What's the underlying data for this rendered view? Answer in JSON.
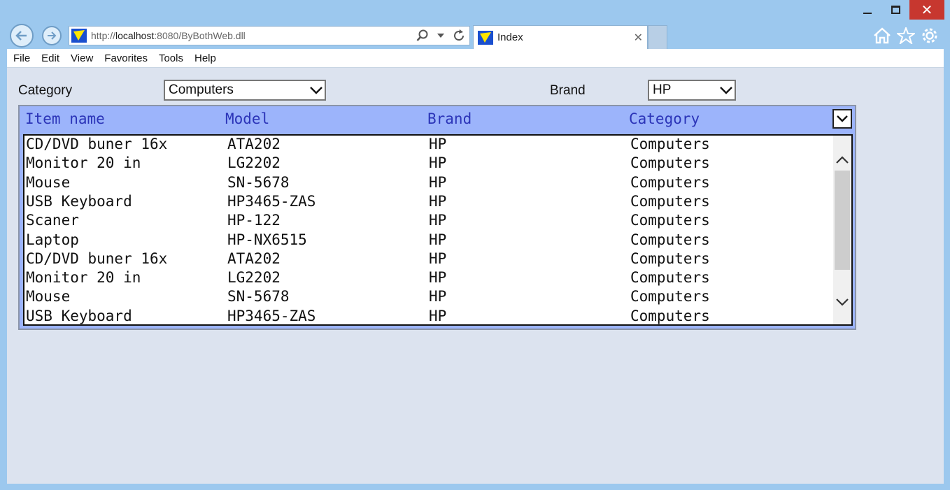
{
  "browser": {
    "url_prefix": "http://",
    "url_host": "localhost",
    "url_rest": ":8080/ByBothWeb.dll",
    "tab_title": "Index",
    "menu": [
      "File",
      "Edit",
      "View",
      "Favorites",
      "Tools",
      "Help"
    ]
  },
  "filters": {
    "category_label": "Category",
    "category_value": "Computers",
    "brand_label": "Brand",
    "brand_value": "HP"
  },
  "grid": {
    "columns": [
      "Item name",
      "Model",
      "Brand",
      "Category"
    ],
    "rows": [
      [
        "CD/DVD buner 16x",
        "ATA202",
        "HP",
        "Computers"
      ],
      [
        "Monitor 20 in",
        "LG2202",
        "HP",
        "Computers"
      ],
      [
        "Mouse",
        "SN-5678",
        "HP",
        "Computers"
      ],
      [
        "USB Keyboard",
        "HP3465-ZAS",
        "HP",
        "Computers"
      ],
      [
        "Scaner",
        "HP-122",
        "HP",
        "Computers"
      ],
      [
        "Laptop",
        "HP-NX6515",
        "HP",
        "Computers"
      ],
      [
        "CD/DVD buner 16x",
        "ATA202",
        "HP",
        "Computers"
      ],
      [
        "Monitor 20 in",
        "LG2202",
        "HP",
        "Computers"
      ],
      [
        "Mouse",
        "SN-5678",
        "HP",
        "Computers"
      ],
      [
        "USB Keyboard",
        "HP3465-ZAS",
        "HP",
        "Computers"
      ]
    ]
  }
}
